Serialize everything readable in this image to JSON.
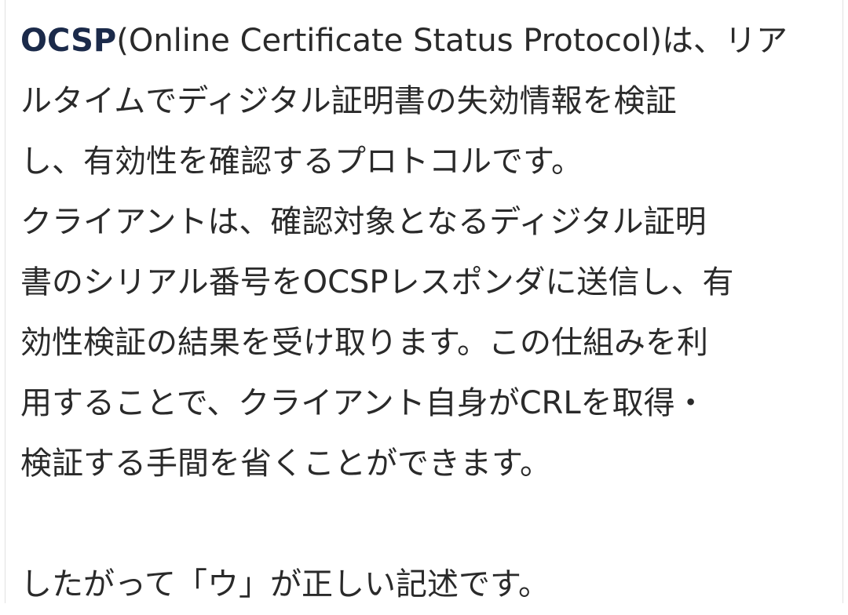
{
  "paragraph1": {
    "term": "OCSP",
    "line1_rest": "(Online Certificate Status Protocol)は、リア",
    "line2": "ルタイムでディジタル証明書の失効情報を検証",
    "line3": "し、有効性を確認するプロトコルです。",
    "line4": "クライアントは、確認対象となるディジタル証明",
    "line5": "書のシリアル番号をOCSPレスポンダに送信し、有",
    "line6": "効性検証の結果を受け取ります。この仕組みを利",
    "line7": "用することで、クライアント自身がCRLを取得・",
    "line8": "検証する手間を省くことができます。"
  },
  "conclusion": "したがって「ウ」が正しい記述です。",
  "colors": {
    "term": "#1b2a4a",
    "text": "#2a2a2a",
    "background": "#ffffff"
  }
}
